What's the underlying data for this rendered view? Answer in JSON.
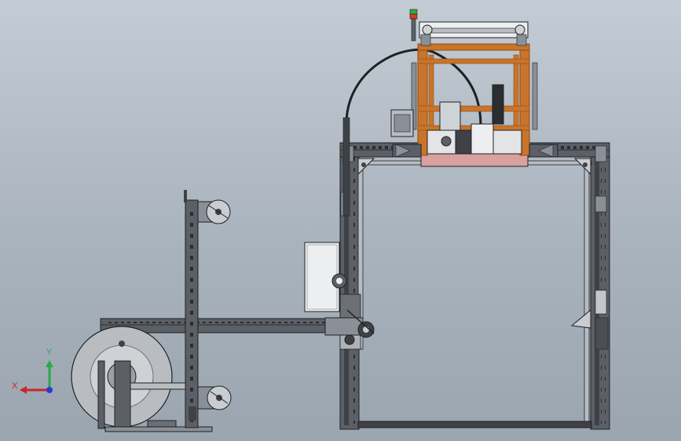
{
  "viewport": {
    "background": [
      "#c3cbd4",
      "#9aa5b0"
    ]
  },
  "colors": {
    "steel": "#5c6066",
    "steel_dark": "#3e4247",
    "steel_light": "#8a9097",
    "outline": "#1e2124",
    "orange_frame": "#c9742a",
    "orange_dark": "#8d4c16",
    "panel_white": "#eceef0",
    "reel_grey": "#b9bdc1",
    "signal_green": "#2fae3c",
    "signal_red": "#d63a2d",
    "pink_base": "#d9a0a0"
  },
  "triad": {
    "x_label": "X",
    "y_label": "Y",
    "x_color": "#c8262a",
    "y_color": "#2aa84a",
    "z_color": "#2a3ad0",
    "icon": "coordinate-triad-icon"
  }
}
